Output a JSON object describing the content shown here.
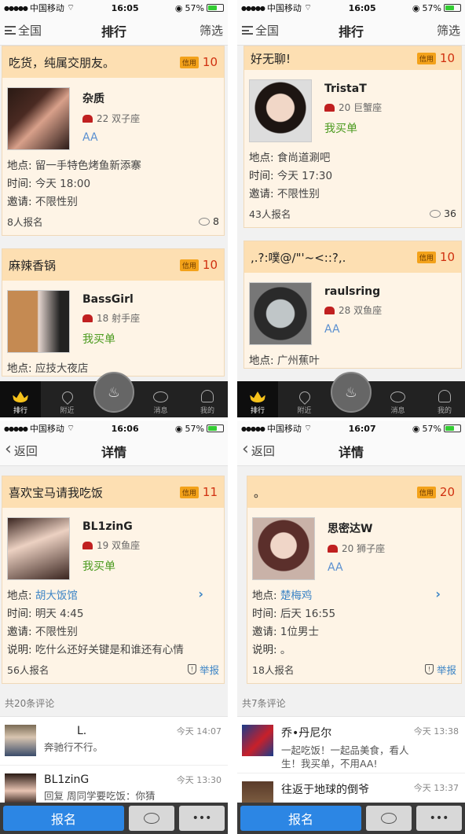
{
  "screens": [
    {
      "status": {
        "carrier": "中国移动",
        "time": "16:05",
        "battery": "57%"
      },
      "nav": {
        "left": "全国",
        "title": "排行",
        "right": "筛选"
      },
      "cards": [
        {
          "title": "吃货，纯属交朋友。",
          "badge": "信用",
          "score": "10",
          "name": "杂质",
          "age_sign": "22 双子座",
          "pay": "AA",
          "location_label": "地点:",
          "location": "留一手特色烤鱼新添寨",
          "time_label": "时间:",
          "time": "今天 18:00",
          "invite_label": "邀请:",
          "invite": "不限性别",
          "signups": "8人报名",
          "comments": "8"
        },
        {
          "title": "麻辣香锅",
          "badge": "信用",
          "score": "10",
          "name": "BassGirl",
          "age_sign": "18 射手座",
          "pay": "我买单",
          "location_label": "地点:",
          "location": "应技大夜店"
        }
      ],
      "tabs": [
        "排行",
        "附近",
        "消息",
        "我的"
      ]
    },
    {
      "status": {
        "carrier": "中国移动",
        "time": "16:05",
        "battery": "57%"
      },
      "nav": {
        "left": "全国",
        "title": "排行",
        "right": "筛选"
      },
      "cards": [
        {
          "title": "好无聊!",
          "badge": "信用",
          "score": "10",
          "name": "TristaT",
          "age_sign": "20 巨蟹座",
          "pay": "我买单",
          "location_label": "地点:",
          "location": "食尚道涮吧",
          "time_label": "时间:",
          "time": "今天 17:30",
          "invite_label": "邀请:",
          "invite": "不限性别",
          "signups": "43人报名",
          "comments": "36"
        },
        {
          "title": ",.?:噗@/\"'~<::?,.",
          "badge": "信用",
          "score": "10",
          "name": "raulsring",
          "age_sign": "28 双鱼座",
          "pay": "AA",
          "location_label": "地点:",
          "location": "广州蕉叶"
        }
      ],
      "tabs": [
        "排行",
        "附近",
        "消息",
        "我的"
      ]
    },
    {
      "status": {
        "carrier": "中国移动",
        "time": "16:06",
        "battery": "57%"
      },
      "nav": {
        "left": "返回",
        "title": "详情"
      },
      "card": {
        "title": "喜欢宝马请我吃饭",
        "badge": "信用",
        "score": "11",
        "name": "BL1zinG",
        "age_sign": "19 双鱼座",
        "pay": "我买单",
        "location_label": "地点:",
        "location": "胡大饭馆",
        "time_label": "时间:",
        "time": "明天 4:45",
        "invite_label": "邀请:",
        "invite": "不限性别",
        "note_label": "说明:",
        "note": "吃什么还好关键是和谁还有心情",
        "signups": "56人报名",
        "report": "举报"
      },
      "comment_count": "共20条评论",
      "comments": [
        {
          "name": "L.",
          "text": "奔驰行不行。",
          "time": "今天 14:07"
        },
        {
          "name": "BL1zinG",
          "text": "回复 周同学要吃饭：你猜",
          "time": "今天 13:30"
        }
      ],
      "action": {
        "signup": "报名",
        "more": "•••"
      }
    },
    {
      "status": {
        "carrier": "中国移动",
        "time": "16:07",
        "battery": "57%"
      },
      "nav": {
        "left": "返回",
        "title": "详情"
      },
      "card": {
        "title": "。",
        "badge": "信用",
        "score": "20",
        "name": "思密达W",
        "age_sign": "20 狮子座",
        "pay": "AA",
        "location_label": "地点:",
        "location": "楚梅鸡",
        "time_label": "时间:",
        "time": "后天 16:55",
        "invite_label": "邀请:",
        "invite": "1位男士",
        "note_label": "说明:",
        "note": "。",
        "signups": "18人报名",
        "report": "举报"
      },
      "comment_count": "共7条评论",
      "comments": [
        {
          "name": "乔•丹尼尔",
          "text": "一起吃饭！一起品美食，看人生！我买单，不用AA!",
          "time": "今天 13:38"
        },
        {
          "name": "往返于地球的倒爷",
          "text": "",
          "time": "今天 13:37"
        }
      ],
      "action": {
        "signup": "报名",
        "more": "•••"
      }
    }
  ]
}
